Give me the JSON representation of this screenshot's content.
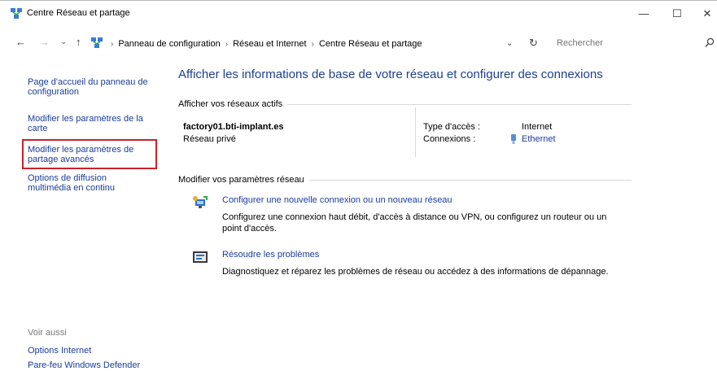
{
  "window": {
    "title": "Centre Réseau et partage",
    "controls": {
      "minimize": "—",
      "maximize": "☐",
      "close": "✕"
    }
  },
  "nav": {
    "back": "←",
    "forward": "→",
    "recent": "⌄",
    "up": "↑"
  },
  "address": {
    "crumbs": [
      "Panneau de configuration",
      "Réseau et Internet",
      "Centre Réseau et partage"
    ],
    "separator": "›",
    "dropdown": "⌄",
    "refresh": "↻"
  },
  "search": {
    "placeholder": "Rechercher"
  },
  "sidebar": {
    "items": [
      {
        "label_lines": [
          "Page d'accueil du panneau de",
          "configuration"
        ]
      },
      {
        "label_lines": [
          "Modifier les paramètres de la",
          "carte"
        ]
      },
      {
        "label_lines": [
          "Modifier les paramètres de",
          "partage avancés"
        ]
      },
      {
        "label_lines": [
          "Options de diffusion",
          "multimédia en continu"
        ]
      }
    ],
    "see_also_heading": "Voir aussi",
    "see_also": [
      "Options Internet",
      "Pare-feu Windows Defender"
    ]
  },
  "main": {
    "title": "Afficher les informations de base de votre réseau et configurer des connexions",
    "active_networks": {
      "heading": "Afficher vos réseaux actifs",
      "name": "factory01.bti-implant.es",
      "type": "Réseau privé",
      "access_label": "Type d'accès :",
      "access_value": "Internet",
      "connections_label": "Connexions :",
      "connections_value": "Ethernet"
    },
    "change_settings": {
      "heading": "Modifier vos paramètres réseau",
      "tasks": [
        {
          "link": "Configurer une nouvelle connexion ou un nouveau réseau",
          "desc_lines": [
            "Configurez une connexion haut débit, d'accès à distance ou VPN, ou configurez un routeur ou un",
            "point d'accès."
          ]
        },
        {
          "link": "Résoudre les problèmes",
          "desc_lines": [
            "Diagnostiquez et réparez les problèmes de réseau ou accédez à des informations de dépannage."
          ]
        }
      ]
    }
  },
  "colors": {
    "link": "#1a3d9c",
    "title": "#1e3f8f",
    "highlight": "#c8222b"
  }
}
